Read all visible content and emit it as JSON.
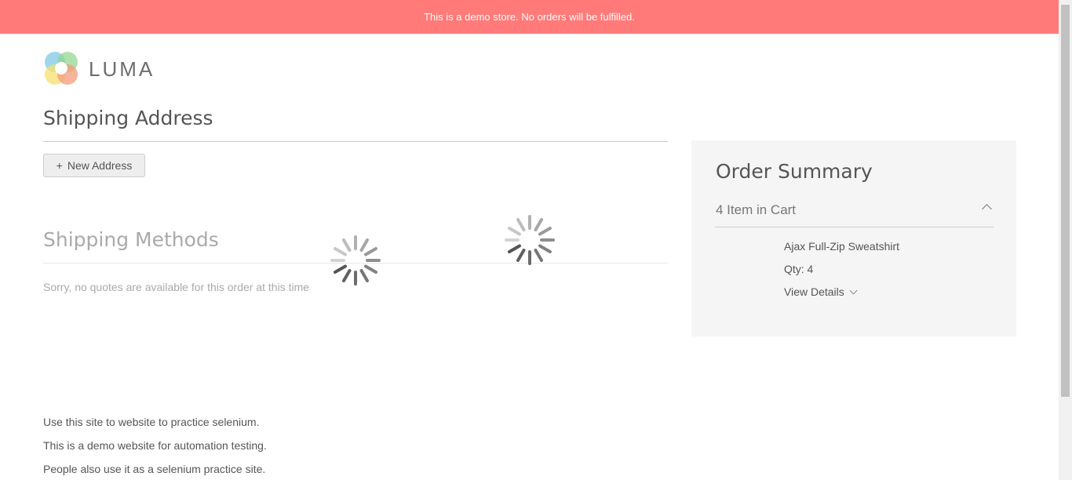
{
  "banner": {
    "text": "This is a demo store. No orders will be fulfilled."
  },
  "brand": {
    "name": "LUMA"
  },
  "shipping": {
    "title": "Shipping Address",
    "new_address_plus": "+",
    "new_address_label": "New Address"
  },
  "methods": {
    "title": "Shipping Methods",
    "message": "Sorry, no quotes are available for this order at this time"
  },
  "summary": {
    "title": "Order Summary",
    "cart_count_text": "4 Item in Cart",
    "item": {
      "name": "Ajax Full-Zip Sweatshirt",
      "qty": "Qty: 4",
      "view_details": "View Details"
    }
  },
  "footer": {
    "lines": [
      "Use this site to website to practice selenium.",
      "This is a demo website for automation testing.",
      "People also use it as a selenium practice site."
    ]
  },
  "colors": {
    "banner_bg": "#ff7a78",
    "summary_bg": "#f5f5f5"
  },
  "icons": {
    "logo": "luma-logo-icon",
    "spinner": "loading-spinner-icon",
    "collapse": "chevron-up-icon",
    "expand": "chevron-down-icon"
  }
}
